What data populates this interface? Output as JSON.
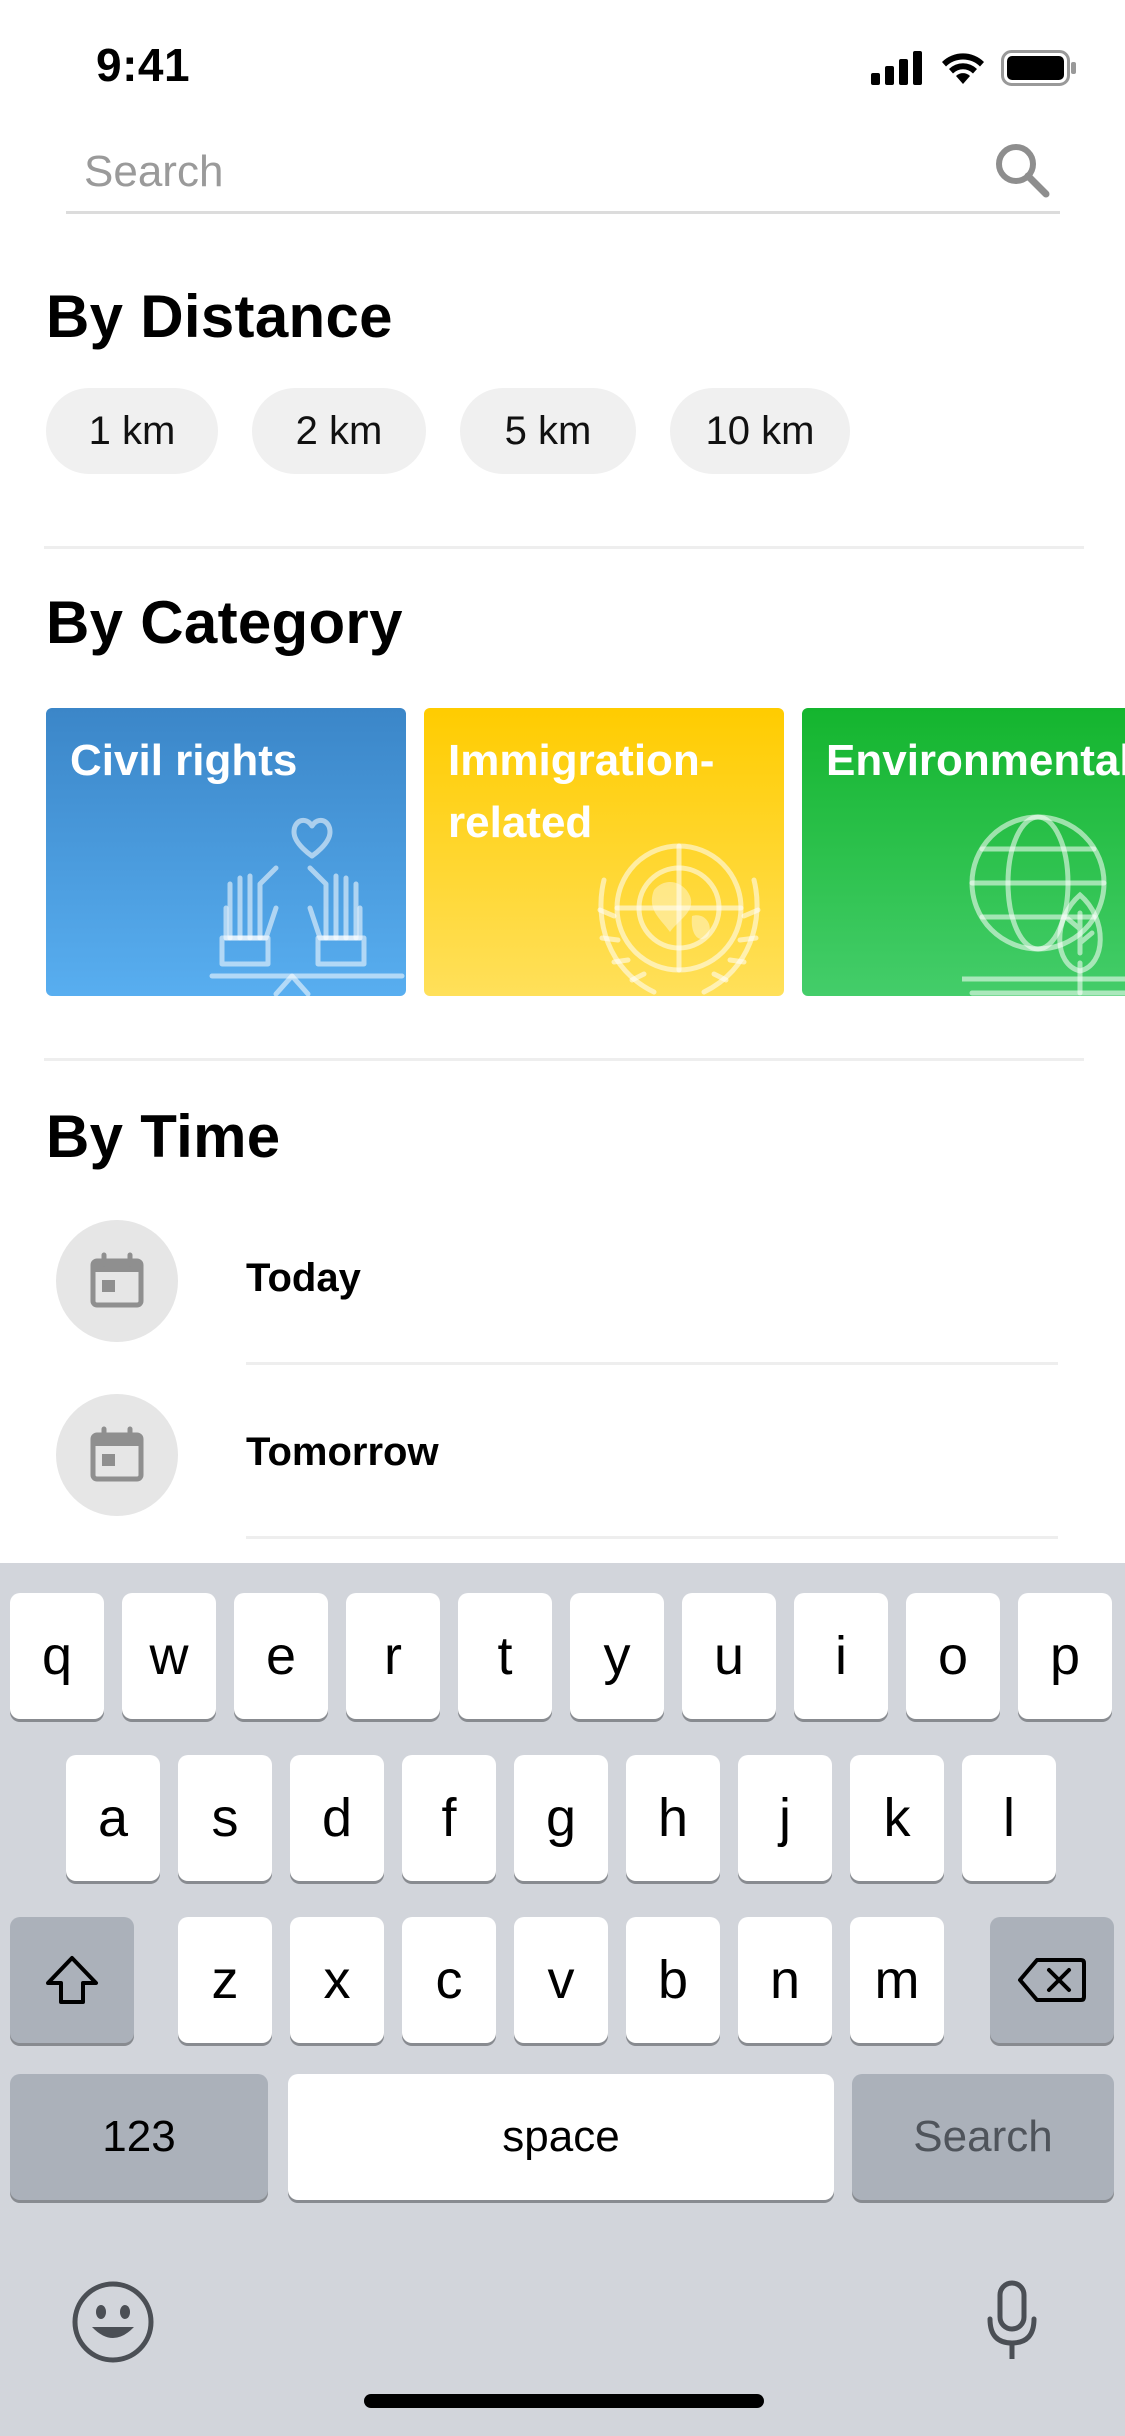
{
  "status_bar": {
    "time": "9:41"
  },
  "search": {
    "placeholder": "Search",
    "value": ""
  },
  "sections": {
    "distance": {
      "title": "By Distance",
      "chips": [
        "1 km",
        "2 km",
        "5 km",
        "10 km"
      ]
    },
    "category": {
      "title": "By Category",
      "cards": [
        {
          "label": "Civil rights",
          "color_top": "#3b86c8",
          "color_bottom": "#58aef0",
          "icon": "raised-hands-heart-icon"
        },
        {
          "label": "Immigration-\nrelated",
          "color_top": "#ffcc00",
          "color_bottom": "#ffe05a",
          "icon": "un-globe-laurel-icon"
        },
        {
          "label": "Environmental",
          "color_top": "#14b52e",
          "color_bottom": "#44cd6a",
          "icon": "globe-leaf-icon"
        }
      ]
    },
    "time": {
      "title": "By Time",
      "items": [
        {
          "label": "Today",
          "icon": "calendar-icon"
        },
        {
          "label": "Tomorrow",
          "icon": "calendar-icon"
        }
      ]
    }
  },
  "keyboard": {
    "row1": [
      "q",
      "w",
      "e",
      "r",
      "t",
      "y",
      "u",
      "i",
      "o",
      "p"
    ],
    "row2": [
      "a",
      "s",
      "d",
      "f",
      "g",
      "h",
      "j",
      "k",
      "l"
    ],
    "row3": [
      "z",
      "x",
      "c",
      "v",
      "b",
      "n",
      "m"
    ],
    "numbers_label": "123",
    "space_label": "space",
    "return_label": "Search",
    "icons": [
      "shift-icon",
      "backspace-icon",
      "emoji-icon",
      "microphone-icon"
    ]
  }
}
